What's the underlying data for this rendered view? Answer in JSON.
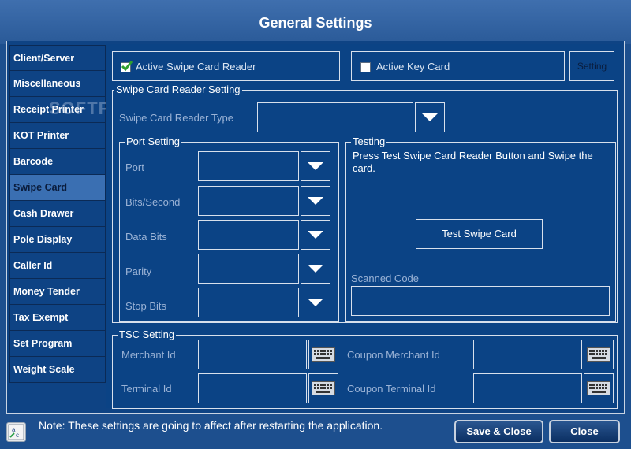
{
  "window": {
    "title": "General Settings"
  },
  "watermark": "SOFTPEDIA",
  "sidebar": {
    "items": [
      {
        "label": "Client/Server",
        "active": false
      },
      {
        "label": "Miscellaneous",
        "active": false
      },
      {
        "label": "Receipt Printer",
        "active": false
      },
      {
        "label": "KOT Printer",
        "active": false
      },
      {
        "label": "Barcode",
        "active": false
      },
      {
        "label": "Swipe Card",
        "active": true
      },
      {
        "label": "Cash Drawer",
        "active": false
      },
      {
        "label": "Pole Display",
        "active": false
      },
      {
        "label": "Caller Id",
        "active": false
      },
      {
        "label": "Money Tender",
        "active": false
      },
      {
        "label": "Tax Exempt",
        "active": false
      },
      {
        "label": "Set Program",
        "active": false
      },
      {
        "label": "Weight Scale",
        "active": false
      }
    ]
  },
  "top": {
    "active_swipe_label": "Active Swipe Card Reader",
    "active_swipe_checked": true,
    "active_key_label": "Active Key Card",
    "active_key_checked": false,
    "setting_button": "Setting"
  },
  "swipe_reader": {
    "legend": "Swipe Card Reader Setting",
    "type_label": "Swipe Card Reader Type",
    "type_value": ""
  },
  "port": {
    "legend": "Port Setting",
    "fields": [
      {
        "label": "Port",
        "value": ""
      },
      {
        "label": "Bits/Second",
        "value": ""
      },
      {
        "label": "Data Bits",
        "value": ""
      },
      {
        "label": "Parity",
        "value": ""
      },
      {
        "label": "Stop Bits",
        "value": ""
      }
    ]
  },
  "testing": {
    "legend": "Testing",
    "instructions": "Press Test Swipe Card Reader Button and Swipe the card.",
    "test_button": "Test Swipe Card",
    "scanned_label": "Scanned Code",
    "scanned_value": ""
  },
  "tsc": {
    "legend": "TSC Setting",
    "merchant_label": "Merchant Id",
    "terminal_label": "Terminal Id",
    "coupon_merchant_label": "Coupon Merchant Id",
    "coupon_terminal_label": "Coupon Terminal Id"
  },
  "footer": {
    "note": "Note: These settings are going to affect after restarting the application.",
    "save_close": "Save & Close",
    "close": "Close"
  }
}
